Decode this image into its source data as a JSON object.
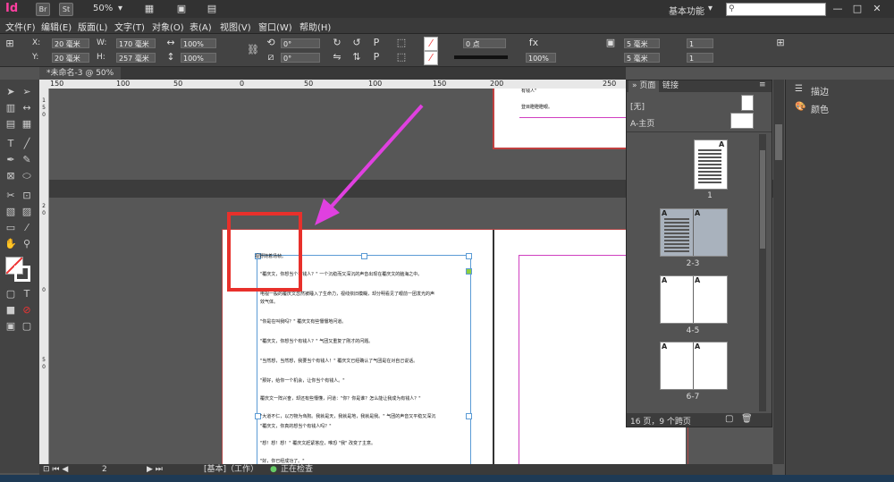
{
  "app": {
    "logo": "Id",
    "br_label": "Br",
    "st_label": "St",
    "zoom": "50%",
    "workspace": "基本功能",
    "window_min": "—",
    "window_max": "□",
    "window_close": "✕"
  },
  "menu": [
    "文件(F)",
    "编辑(E)",
    "版面(L)",
    "文字(T)",
    "对象(O)",
    "表(A)",
    "视图(V)",
    "窗口(W)",
    "帮助(H)"
  ],
  "control": {
    "x_label": "X:",
    "x_value": "20 毫米",
    "y_label": "Y:",
    "y_value": "20 毫米",
    "w_label": "W:",
    "w_value": "170 毫米",
    "h_label": "H:",
    "h_value": "257 毫米",
    "scale_x": "100%",
    "scale_y": "100%",
    "rotate": "0°",
    "shear": "0°",
    "stroke_weight": "0 点",
    "opacity": "100%",
    "gutter_1": "5 毫米",
    "gutter_2": "5 毫米",
    "columns": "1",
    "count_2": "1"
  },
  "document": {
    "tab_label": "*未命名-3 @ 50%"
  },
  "ruler": {
    "h_ticks": [
      "150",
      "100",
      "50",
      "0",
      "50",
      "100",
      "150",
      "200",
      "250"
    ],
    "v_ticks": [
      "1",
      "5",
      "0",
      "2",
      "0",
      "0",
      "5",
      "0"
    ]
  },
  "page_top": {
    "line1": "有钱人\"",
    "line2": "登目瞪瞪瞪眼。"
  },
  "page_text": [
    "视野随着场帧。",
    "\"覆庆文，你想当个有钱人？\" 一个沉稳而又深沉的声音出现在覆庆文的脑海之中。",
    "电视一般的覆庆文忽然被睡入了生命力，视线依旧模糊，却分明看见了眼前一团发光的声",
    "效气体。",
    "\"你是在叫我吗？\" 覆庆文有些懵懵地问道。",
    "\"覆庆文，你想当个有钱人？\" 气团又重复了刚才的问题。",
    "\"当然想，当然想，我要当个有钱人！\" 覆庆文已经确认了气团是在对自己说话。",
    "\"那好，给你一个机会，让你当个有钱人。\"",
    "覆庆文一阵兴奋，却还有些懵懂，问道：\"你？你是谁？怎么能让我成为有钱人？\"",
    "\"大道不仁，以万物为刍狗。我就是天，我就是地，我就是我。\" 气团的声音又平稳又深沉",
    "\"覆庆文，你真的想当个有钱人吗？\"",
    "\"想！想！想！\" 覆庆文赶紧答应，唯恐 \"我\" 改变了主意。",
    "\"好，你已经成功了。\""
  ],
  "pages_panel": {
    "tab_pages": "页面",
    "tab_links": "链接",
    "none_master": "[无]",
    "a_master": "A-主页",
    "letter_a": "A",
    "thumb_labels": [
      "1",
      "2-3",
      "4-5",
      "6-7"
    ],
    "footer": "16 页，9 个跨页"
  },
  "right_panel": {
    "stroke_label": "描边",
    "color_label": "颜色"
  },
  "status": {
    "page_num": "2",
    "style": "[基本]（工作）",
    "preflight": "正在检查"
  }
}
